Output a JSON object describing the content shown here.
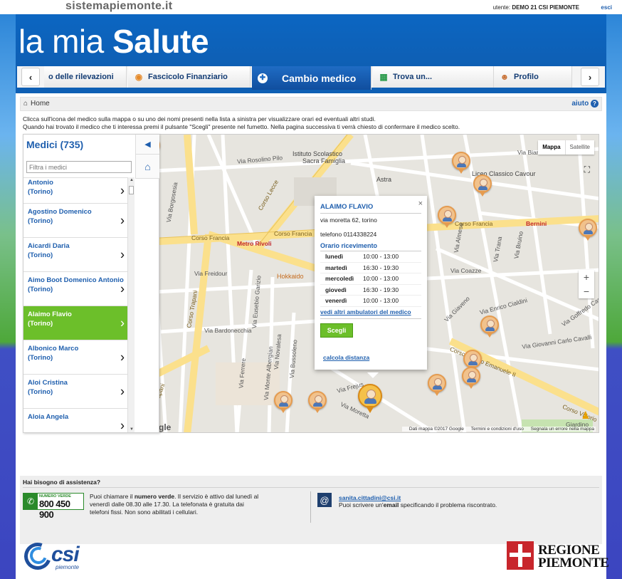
{
  "site": {
    "logo": "sistemapiemonte.it",
    "user_label": "utente:",
    "user_name": "DEMO 21 CSI PIEMONTE",
    "logout": "esci"
  },
  "header": {
    "brand_part1": "la mia",
    "brand_part2": "Salute"
  },
  "tabs": [
    {
      "label": "o delle rilevazioni",
      "icon": "chart-icon"
    },
    {
      "label": "Fascicolo Finanziario",
      "icon": "piggy-bank-icon"
    },
    {
      "label": "Cambio medico",
      "icon": "doctor-icon",
      "active": true
    },
    {
      "label": "Trova un...",
      "icon": "map-icon"
    },
    {
      "label": "Profilo",
      "icon": "user-icon"
    }
  ],
  "nav": {
    "prev": "‹",
    "next": "›"
  },
  "breadcrumb": {
    "home": "Home",
    "help": "aiuto"
  },
  "intro": {
    "line1": "Clicca sull'icona del medico sulla mappa o su uno dei nomi presenti nella lista a sinistra per visualizzare orari ed eventuali altri studi.",
    "line2": "Quando hai trovato il medico che ti interessa premi il pulsante \"Scegli\" presente nel fumetto. Nella pagina successiva ti verrà chiesto di confermare il medico scelto."
  },
  "list": {
    "title": "Medici (735)",
    "filter_placeholder": "Filtra i medici",
    "items": [
      {
        "name": "Antonio",
        "city": "(Torino)"
      },
      {
        "name": "Agostino Domenico",
        "city": "(Torino)"
      },
      {
        "name": "Aicardi Daria",
        "city": "(Torino)"
      },
      {
        "name": "Aimo Boot Domenico Antonio",
        "city": "(Torino)"
      },
      {
        "name": "Alaimo Flavio",
        "city": "(Torino)",
        "selected": true
      },
      {
        "name": "Albonico Marco",
        "city": "(Torino)"
      },
      {
        "name": "Aloi Cristina",
        "city": "(Torino)"
      },
      {
        "name": "Aloia Angela",
        "city": ""
      }
    ]
  },
  "map": {
    "type_map": "Mappa",
    "type_sat": "Satellite",
    "zoom_in": "+",
    "zoom_out": "−",
    "google": "Google",
    "footer_data": "Dati mappa ©2017 Google",
    "footer_terms": "Termini e condizioni d'uso",
    "footer_report": "Segnala un errore nella mappa",
    "labels": {
      "istituto": "Istituto Scolastico",
      "sacra": "Sacra Famiglia",
      "astra": "Astra",
      "liceo": "Liceo Classico Cavour",
      "corso_francia_l": "Corso Francia",
      "corso_francia_c": "Corso Francia",
      "corso_francia_r": "Corso Francia",
      "metro_rivoli": "Metro Rivoli",
      "bernini": "Bernini",
      "hokkaido": "Hokkaido",
      "via_freidour": "Via Freidour",
      "via_bardonecchia": "Via Bardonecchia",
      "corso_trapani": "Corso Trapani",
      "corso_trapani2": "Corso Trapani",
      "corso_lecce": "Corso Lecce",
      "rosolino_pilo": "Via Rosolino Pilo",
      "via_borgosesia": "Via Borgosesia",
      "via_eusebio": "Via Eusebio Garizio",
      "via_ferrere": "Via Ferrere",
      "via_monte_albergian": "Via Monte Albergian",
      "via_novalesa": "Via Novalesa",
      "via_bussoleno": "Via Bussoleno",
      "corso_vittorio": "Corso Vittorio Emanuele II",
      "corso_vittorio2": "Corso Vittorio",
      "via_giovanni_carlo": "Via Giovanni Carlo Cavalli",
      "via_goffredo": "Via Goffredo Casalis",
      "via_enrico_cialdini": "Via Enrico Cialdini",
      "via_coazze": "Via Coazze",
      "via_trana": "Via Trana",
      "via_bruino": "Via Bruino",
      "via_giaveno": "Via Giaveno",
      "via_almese": "Via Almese",
      "via_frejus": "Via Frejus",
      "via_moretta": "Via Moretta",
      "via_bianze": "Via Bianzè",
      "giardino": "Giardino"
    }
  },
  "popup": {
    "name": "ALAIMO FLAVIO",
    "address": "via moretta 62, torino",
    "phone": "telefono 0114338224",
    "schedule_title": "Orario ricevimento",
    "schedule": [
      {
        "day": "lunedì",
        "hours": "10:00 - 13:00"
      },
      {
        "day": "martedì",
        "hours": "16:30 - 19:30"
      },
      {
        "day": "mercoledì",
        "hours": "10:00 - 13:00"
      },
      {
        "day": "giovedì",
        "hours": "16:30 - 19:30"
      },
      {
        "day": "venerdì",
        "hours": "10:00 - 13:00"
      }
    ],
    "more_link": "vedi altri ambulatori del medico",
    "choose": "Scegli",
    "distance": "calcola distanza",
    "close": "×"
  },
  "assist": {
    "title": "Hai bisogno di assistenza?",
    "nv_small": "NUMERO VERDE",
    "nv_number": "800 450 900",
    "nv_text_pre": "Puoi chiamare il ",
    "nv_text_bold": "numero verde",
    "nv_text_post": ". Il servizio è attivo dal lunedì al venerdì dalle 08.30 alle 17.30. La telefonata è gratuita dai telefoni fissi. Non sono abilitati i cellulari.",
    "email": "sanita.cittadini@csi.it",
    "email_text_pre": "Puoi scrivere un'",
    "email_text_bold": "email",
    "email_text_post": " specificando il problema riscontrato."
  },
  "logos": {
    "csi": "csi",
    "csi_sub": "piemonte",
    "regione_l1": "REGIONE",
    "regione_l2": "PIEMONTE"
  }
}
